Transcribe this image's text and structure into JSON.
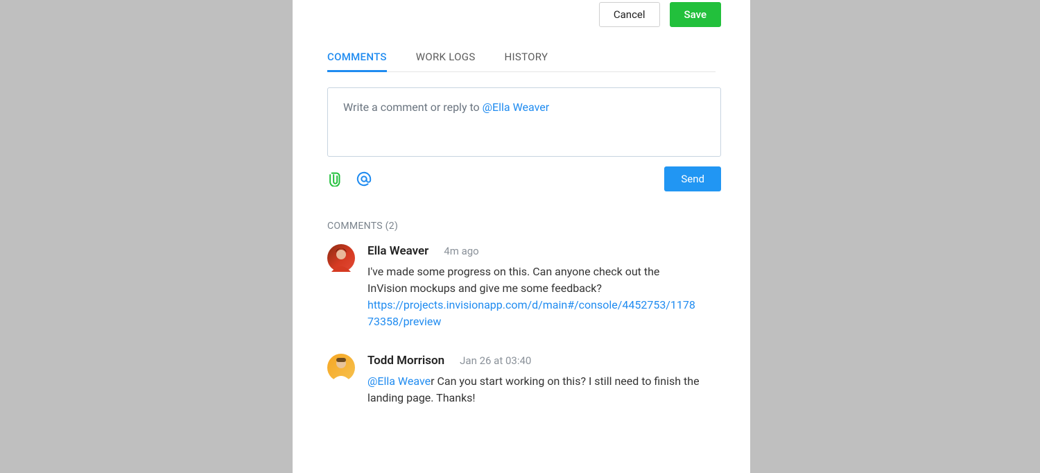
{
  "actions": {
    "cancel": "Cancel",
    "save": "Save"
  },
  "tabs": {
    "comments": "Comments",
    "worklogs": "Work Logs",
    "history": "History"
  },
  "composer": {
    "placeholder_prefix": "Write a comment or reply to ",
    "placeholder_mention": "@Ella Weaver",
    "send": "Send"
  },
  "comments_header_prefix": "Comments",
  "comments_count": "2",
  "comments": [
    {
      "author": "Ella Weaver",
      "time": "4m ago",
      "text_before": "I've made some progress on this. Can anyone check out the InVision mockups and give me some feedback?",
      "link": "https://projects.invisionapp.com/d/main#/console/4452753/117873358/preview",
      "mention": "",
      "text_after": ""
    },
    {
      "author": "Todd Morrison",
      "time": "Jan 26 at 03:40",
      "text_before": "",
      "link": "",
      "mention": "@Ella Weave",
      "text_after": "r Can you start working on this? I still need to finish the landing page. Thanks!"
    }
  ]
}
